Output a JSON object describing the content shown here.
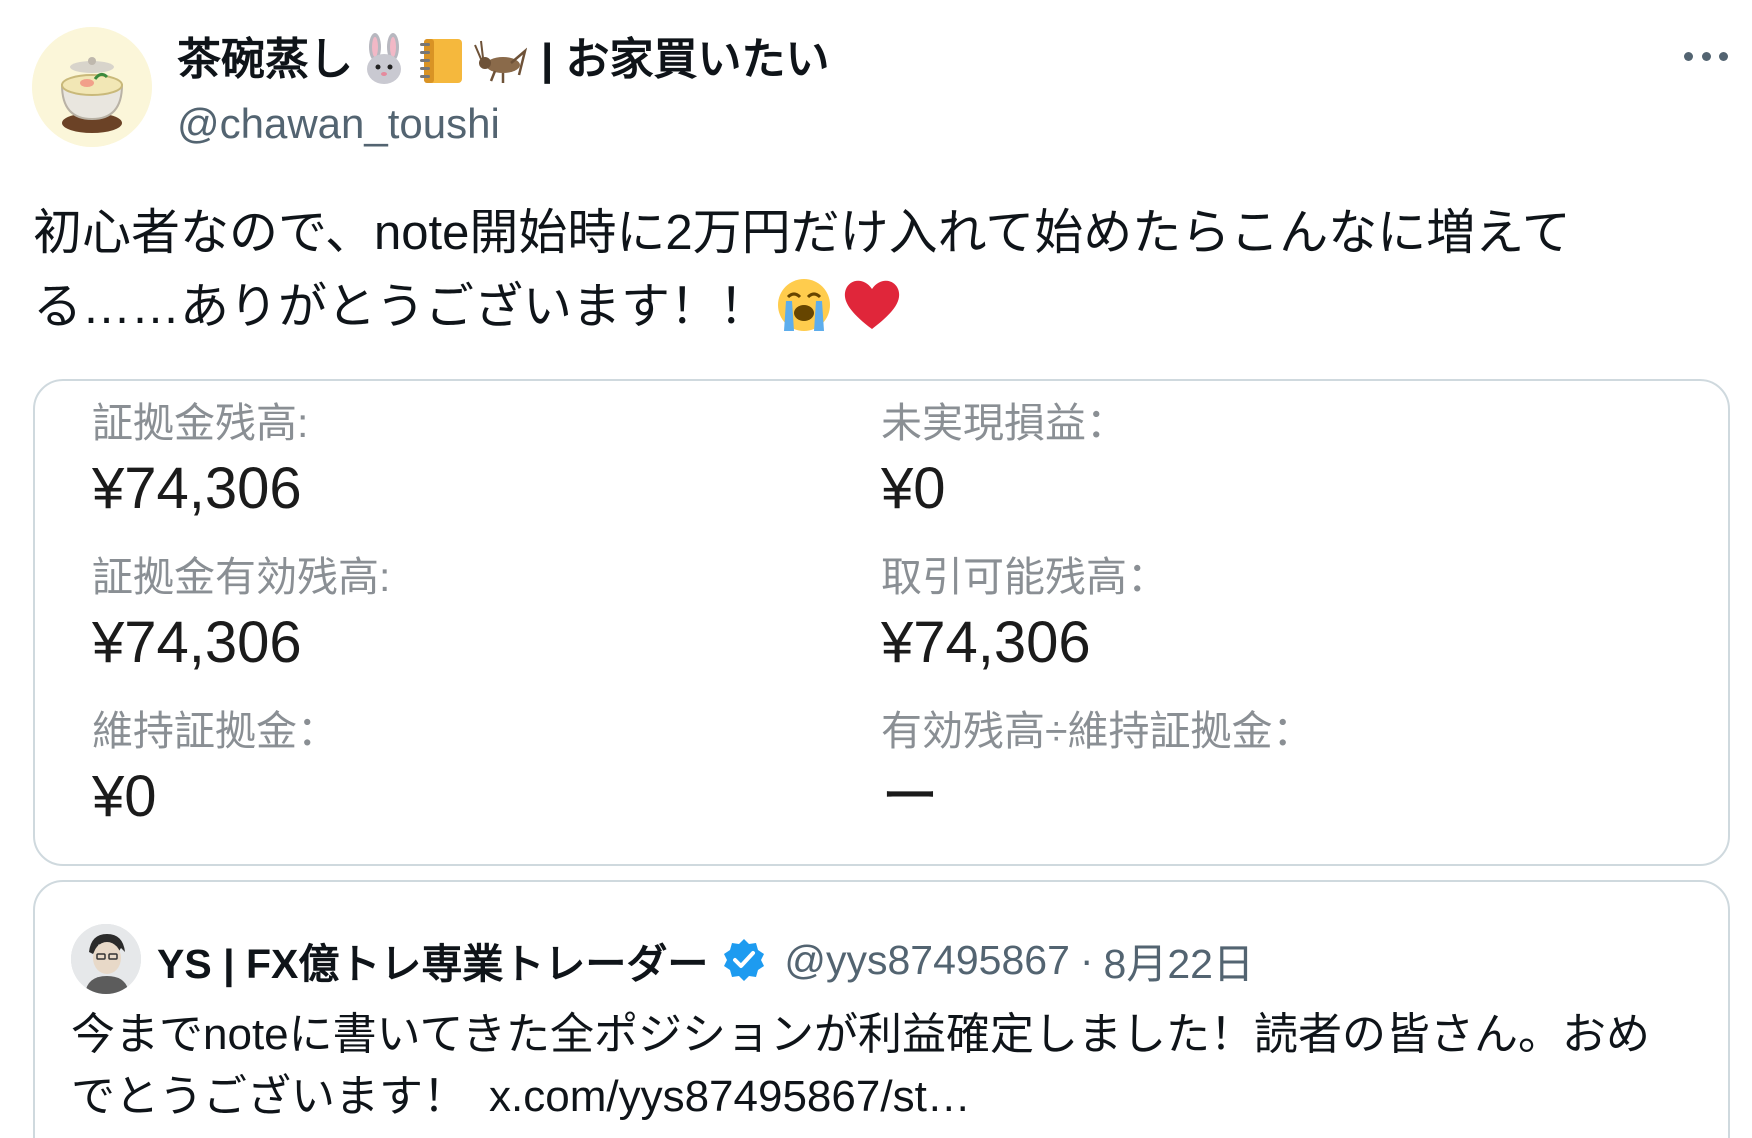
{
  "author": {
    "display_name": "茶碗蒸し",
    "name_suffix": "| お家買いたい",
    "name_emojis": [
      "rabbit-face-icon",
      "ledger-notebook-icon",
      "cricket-icon"
    ],
    "handle": "@chawan_toushi",
    "avatar": "chawanmushi-avatar"
  },
  "tweet": {
    "text": "初心者なので、note開始時に2万円だけ入れて始めたらこんなに増えてる……ありがとうございます！！",
    "trailing_emojis": [
      "loudly-crying-face-icon",
      "red-heart-icon"
    ]
  },
  "account_card": {
    "items": [
      {
        "label": "証拠金残高:",
        "value": "¥74,306"
      },
      {
        "label": "未実現損益：",
        "value": "¥0"
      },
      {
        "label": "証拠金有効残高:",
        "value": "¥74,306"
      },
      {
        "label": "取引可能残高：",
        "value": "¥74,306"
      },
      {
        "label": "維持証拠金：",
        "value": "¥0"
      },
      {
        "label": "有効残高÷維持証拠金：",
        "value": "ー"
      }
    ]
  },
  "quoted_tweet": {
    "name": "YS | FX億トレ専業トレーダー",
    "verified": true,
    "handle": "@yys87495867",
    "separator": "·",
    "date": "8月22日",
    "text": "今までnoteに書いてきた全ポジションが利益確定しました！読者の皆さん。おめでとうございます！",
    "link": "x.com/yys87495867/st…"
  },
  "colors": {
    "text": "#0f1419",
    "secondary": "#536471",
    "border": "#cfd9de",
    "verified": "#1d9bf0",
    "heart": "#e0263a"
  }
}
